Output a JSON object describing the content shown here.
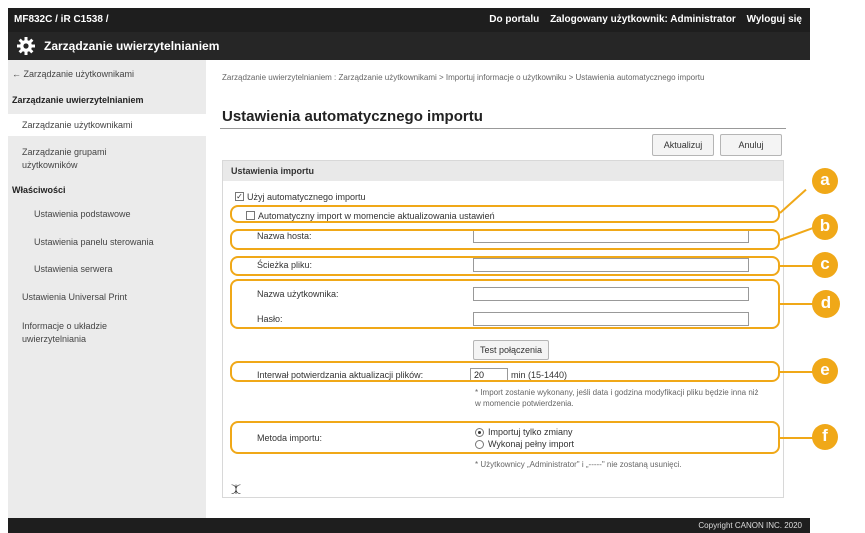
{
  "header": {
    "device": "MF832C / iR C1538 /",
    "links": [
      "Do portalu",
      "Zalogowany użytkownik: Administrator",
      "Wyloguj się"
    ]
  },
  "titlebar": {
    "title": "Zarządzanie uwierzytelnianiem",
    "icon": "gear-icon"
  },
  "sidebar": {
    "back": "← Zarządzanie użytkownikami",
    "section_auth": "Zarządzanie uwierzytelnianiem",
    "users": "Zarządzanie użytkownikami",
    "groups": "Zarządzanie grupami użytkowników",
    "section_props": "Właściwości",
    "basic": "Ustawienia podstawowe",
    "panel": "Ustawienia panelu sterowania",
    "server": "Ustawienia serwera",
    "universal": "Ustawienia Universal Print",
    "info": "Informacje o układzie uwierzytelniania"
  },
  "main": {
    "breadcrumb": "Zarządzanie uwierzytelnianiem : Zarządzanie użytkownikami > Importuj informacje o użytkowniku > Ustawienia automatycznego importu",
    "title": "Ustawienia automatycznego importu",
    "update_button": "Aktualizuj",
    "cancel_button": "Anuluj"
  },
  "form": {
    "section_title": "Ustawienia importu",
    "use_auto_import": {
      "label": "Użyj automatycznego importu",
      "checked": true
    },
    "auto_import_on_update": {
      "label": "Automatyczny import w momencie aktualizowania ustawień",
      "checked": false
    },
    "host_name": {
      "label": "Nazwa hosta:",
      "value": ""
    },
    "file_path": {
      "label": "Ścieżka pliku:",
      "value": ""
    },
    "user_name": {
      "label": "Nazwa użytkownika:",
      "value": ""
    },
    "password": {
      "label": "Hasło:",
      "value": ""
    },
    "test_button": "Test połączenia",
    "interval": {
      "label": "Interwał potwierdzania aktualizacji plików:",
      "value": "20",
      "unit": "min (15-1440)"
    },
    "interval_note": "* Import zostanie wykonany, jeśli data i godzina modyfikacji pliku będzie inna niż w momencie potwierdzenia.",
    "import_method": {
      "label": "Metoda importu:",
      "options": [
        "Importuj tylko zmiany",
        "Wykonaj pełny import"
      ],
      "selected": 0
    },
    "import_note": "* Użytkownicy „Administrator\" i „-----\" nie zostaną usunięci.",
    "scroll_top": "⯰"
  },
  "markers": [
    "a",
    "b",
    "c",
    "d",
    "e",
    "f"
  ],
  "footer": {
    "copyright": "Copyright CANON INC. 2020"
  },
  "colors": {
    "highlight": "#f0a818",
    "topbar": "#1e1e1e",
    "sidebar": "#ebebeb"
  }
}
